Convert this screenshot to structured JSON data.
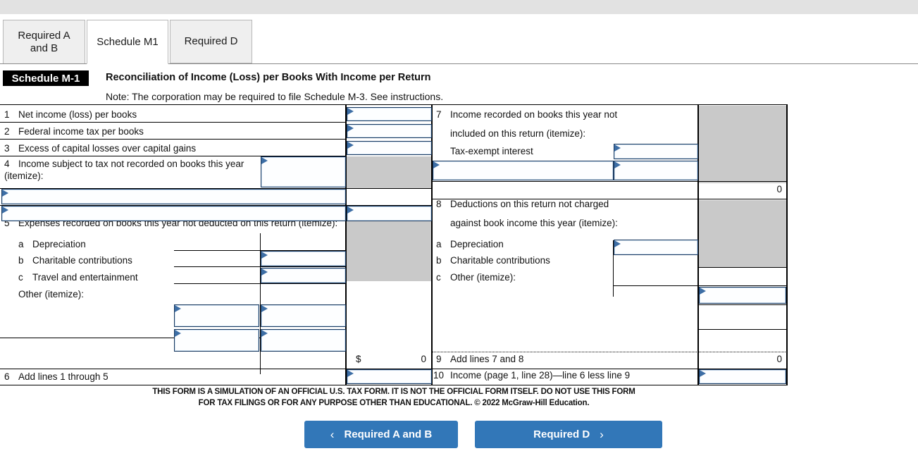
{
  "topbar": {
    "present": true
  },
  "tabs": [
    {
      "label": "Required A and B",
      "active": false,
      "name": "tab-required-a-and-b"
    },
    {
      "label": "Schedule M1",
      "active": true,
      "name": "tab-schedule-m1"
    },
    {
      "label": "Required D",
      "active": false,
      "name": "tab-required-d"
    }
  ],
  "schedule": {
    "badge": "Schedule M-1",
    "title": "Reconciliation of Income (Loss) per Books With Income per Return",
    "note": "Note:  The corporation may be required to file Schedule M-3. See instructions."
  },
  "left_column": {
    "lines": [
      {
        "num": "1",
        "label": "Net income (loss) per books"
      },
      {
        "num": "2",
        "label": "Federal income tax per books"
      },
      {
        "num": "3",
        "label": "Excess of capital losses over capital gains"
      },
      {
        "num": "4",
        "label": "Income subject to tax not recorded on books this year",
        "label2": "(itemize):"
      },
      {
        "num": "5",
        "label": "Expenses recorded on books this year not deducted on this return (itemize):"
      },
      {
        "num": "a",
        "label": "Depreciation"
      },
      {
        "num": "b",
        "label": "Charitable contributions"
      },
      {
        "num": "c",
        "label": "Travel and entertainment"
      },
      {
        "num": "",
        "label": "Other (itemize):"
      },
      {
        "num": "6",
        "label": "Add lines 1 through 5"
      }
    ],
    "dollar_sign": "$",
    "subtotal_value": "0",
    "fields": {
      "line1": "",
      "line2": "",
      "line3": "",
      "line4_desc": "",
      "line4_item1": "",
      "line4_item2_desc": "",
      "line4_item2_amt": "",
      "line5b_amt": "",
      "line5c_amt": "",
      "other1_desc": "",
      "other1_amt": "",
      "other2_desc": "",
      "other2_amt": "",
      "line6": ""
    }
  },
  "right_column": {
    "lines": [
      {
        "num": "7",
        "label": "Income recorded on books this year not"
      },
      {
        "num": "",
        "label": "included on this return (itemize):"
      },
      {
        "num": "",
        "label": "Tax-exempt interest"
      },
      {
        "num": "8",
        "label": "Deductions on this return not charged"
      },
      {
        "num": "",
        "label": "against book income this year (itemize):"
      },
      {
        "num": "a",
        "label": "Depreciation"
      },
      {
        "num": "b",
        "label": "Charitable contributions"
      },
      {
        "num": "c",
        "label": "Other (itemize):"
      },
      {
        "num": "9",
        "label": "Add lines 7 and 8"
      },
      {
        "num": "10",
        "label": "Income (page 1, line 28)—line 6 less line 9"
      }
    ],
    "line7_total": "0",
    "line9_total": "0",
    "fields": {
      "tax_exempt_interest": "",
      "line7_item_desc": "",
      "line7_item_amt": "",
      "line8a_amt": "",
      "line8c_amt": "",
      "line10": ""
    }
  },
  "disclaimer": {
    "line1": "THIS FORM IS A SIMULATION OF AN OFFICIAL U.S. TAX FORM. IT IS NOT THE OFFICIAL FORM ITSELF. DO NOT USE THIS FORM",
    "line2": "FOR TAX FILINGS OR FOR ANY PURPOSE OTHER THAN EDUCATIONAL. © 2022 McGraw-Hill Education."
  },
  "nav": {
    "prev_label": "Required A and B",
    "prev_icon": "chevron-left-icon",
    "prev_chevron": "‹",
    "next_label": "Required D",
    "next_icon": "chevron-right-icon",
    "next_chevron": "›"
  },
  "colors": {
    "accent_blue": "#3277b8",
    "field_border": "#17375e",
    "shaded_cell": "#c9c9c9",
    "badge_bg": "#000000",
    "topbar": "#e2e2e2"
  }
}
